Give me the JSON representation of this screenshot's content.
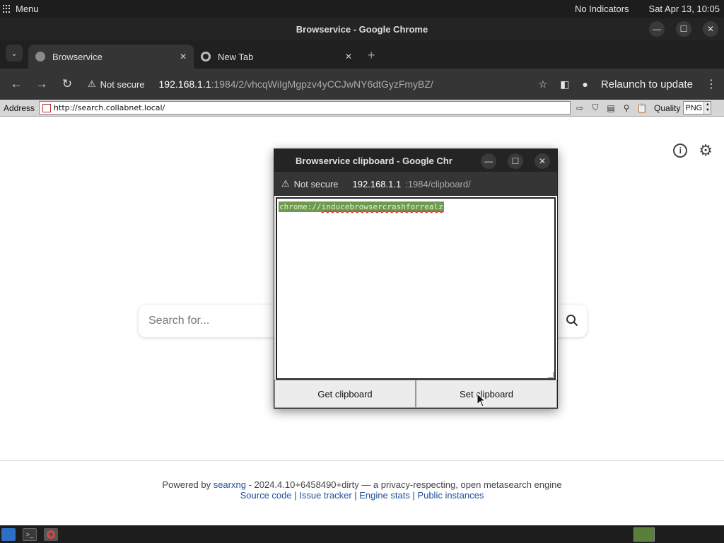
{
  "system_panel": {
    "menu_label": "Menu",
    "indicators": "No Indicators",
    "datetime": "Sat Apr 13, 10:05"
  },
  "window": {
    "title": "Browservice - Google Chrome"
  },
  "tabs": [
    {
      "label": "Browservice",
      "icon": "globe-icon",
      "active": true
    },
    {
      "label": "New Tab",
      "icon": "chrome-icon",
      "active": false
    }
  ],
  "toolbar": {
    "security_label": "Not secure",
    "url_host": "192.168.1.1",
    "url_rest": ":1984/2/vhcqWiIgMgpzv4yCCJwNY6dtGyzFmyBZ/",
    "relaunch_label": "Relaunch to update"
  },
  "browservice_bar": {
    "address_label": "Address",
    "address_value": "http://search.collabnet.local/",
    "quality_label": "Quality",
    "quality_value": "PNG"
  },
  "page": {
    "search_placeholder": "Search for...",
    "footer": {
      "powered_by": "Powered by",
      "engine_link": "searxng",
      "version_text": " - 2024.4.10+6458490+dirty — a privacy-respecting, open metasearch engine",
      "links": [
        "Source code",
        "Issue tracker",
        "Engine stats",
        "Public instances"
      ],
      "separator": " | "
    }
  },
  "popup": {
    "title": "Browservice clipboard - Google Chr",
    "security_label": "Not secure",
    "url_host": "192.168.1.1",
    "url_rest": ":1984/clipboard/",
    "clipboard_prefix": "chrome://",
    "clipboard_rest": "inducebrowsercrashforrealz",
    "get_button": "Get clipboard",
    "set_button": "Set clipboard"
  }
}
